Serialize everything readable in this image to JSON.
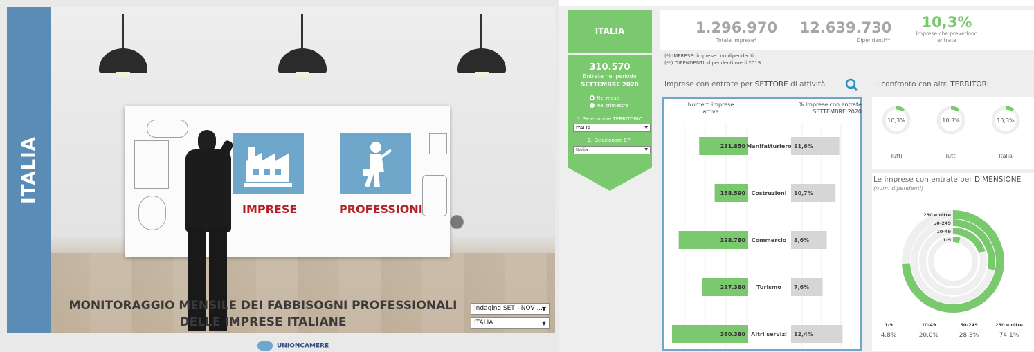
{
  "landing": {
    "vertical_label": "ITALIA",
    "tile_imprese": "IMPRESE",
    "tile_professioni": "PROFESSIONI",
    "title_line1": "MONITORAGGIO MENSILE DEI FABBISOGNI PROFESSIONALI",
    "title_line2": "DELLE IMPRESE ITALIANE",
    "survey_select": "Indagine SET - NOV ...",
    "area_select": "ITALIA",
    "logo_text": "UNIONCAMERE",
    "icons": [
      "factory-icon",
      "professional-person-icon"
    ]
  },
  "filters": {
    "territory_title": "ITALIA",
    "entrate_value": "310.570",
    "entrate_label": "Entrate nel periodo",
    "period_label": "SETTEMBRE 2020",
    "radio_month": "Nel mese",
    "radio_quarter": "Nel trimestre",
    "radio_selected": "Nel mese",
    "label_territorio": "1. Selezionare TERRITORIO",
    "select_territorio": "ITALIA",
    "label_cpi": "2. Selezionare CPI",
    "select_cpi": "Italia"
  },
  "kpis": {
    "totale_imprese": "1.296.970",
    "totale_imprese_label": "Totale Imprese*",
    "dipendenti": "12.639.730",
    "dipendenti_label": "Dipendenti**",
    "pct": "10,3%",
    "pct_label_1": "Imprese che prevedono",
    "pct_label_2": "entrate"
  },
  "notes": {
    "note1": "(*) IMPRESE: imprese con dipendenti",
    "note2": "(**) DIPENDENTI: dipendenti medi 2019"
  },
  "sections": {
    "settore_pre": "Imprese con entrate per ",
    "settore_bold": "SETTORE",
    "settore_post": " di attività",
    "territori_pre": "Il confronto con altri ",
    "territori_bold": "TERRITORI",
    "dim_pre": "Le imprese con entrate per ",
    "dim_bold": "DIMENSIONE",
    "dim_sub": "(num. dipendenti)"
  },
  "chart_data": [
    {
      "type": "bar",
      "title": "Imprese con entrate per SETTORE di attività",
      "col_head_left_1": "Numero imprese",
      "col_head_left_2": "attive",
      "col_head_right_1": "% Imprese con entrate",
      "col_head_right_2": "SETTEMBRE 2020",
      "categories": [
        "Manifatturiero",
        "Costruzioni",
        "Commercio",
        "Turismo",
        "Altri servizi"
      ],
      "series": [
        {
          "name": "Numero imprese attive",
          "values": [
            231850,
            158590,
            328780,
            217380,
            360380
          ],
          "labels": [
            "231.850",
            "158.590",
            "328.780",
            "217.380",
            "360.380"
          ]
        },
        {
          "name": "% Imprese con entrate SETTEMBRE 2020",
          "values": [
            11.6,
            10.7,
            8.6,
            7.6,
            12.4
          ],
          "labels": [
            "11,6%",
            "10,7%",
            "8,6%",
            "7,6%",
            "12,4%"
          ]
        }
      ],
      "colors": {
        "left": "#7bc96f",
        "right": "#d6d6d6"
      }
    },
    {
      "type": "pie",
      "title": "Il confronto con altri TERRITORI",
      "categories": [
        "Tutti",
        "Tutti",
        "Italia"
      ],
      "values": [
        10.3,
        10.3,
        10.3
      ],
      "labels": [
        "10,3%",
        "10,3%",
        "10,3%"
      ]
    },
    {
      "type": "pie",
      "title": "Le imprese con entrate per DIMENSIONE",
      "categories": [
        "1-9",
        "10-49",
        "50-249",
        "250 e oltre"
      ],
      "values": [
        4.8,
        20.0,
        28.3,
        74.1
      ],
      "labels": [
        "4,8%",
        "20,0%",
        "28,3%",
        "74,1%"
      ]
    }
  ],
  "colors": {
    "green": "#7bc96f",
    "blue": "#6ea7c9",
    "red": "#b52026",
    "grey": "#a6a6a6"
  }
}
